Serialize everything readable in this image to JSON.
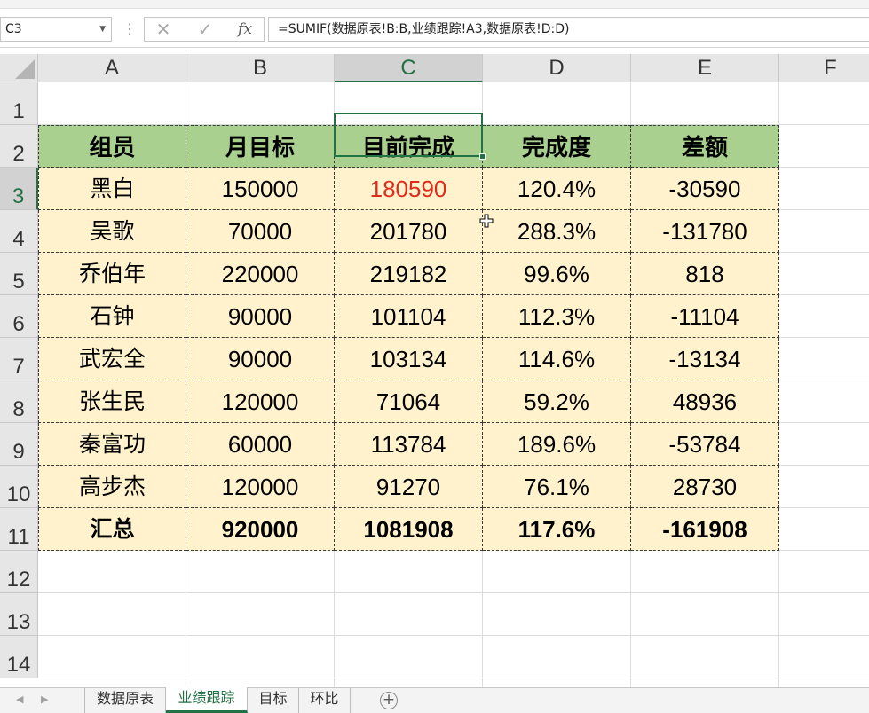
{
  "formula_bar": {
    "name_box": "C3",
    "formula": "=SUMIF(数据原表!B:B,业绩跟踪!A3,数据原表!D:D)",
    "cancel_symbol": "✕",
    "enter_symbol": "✓",
    "fx_symbol": "fx"
  },
  "columns": [
    "A",
    "B",
    "C",
    "D",
    "E",
    "F"
  ],
  "rows": [
    "1",
    "2",
    "3",
    "4",
    "5",
    "6",
    "7",
    "8",
    "9",
    "10",
    "11",
    "12",
    "13",
    "14"
  ],
  "table": {
    "header": [
      "组员",
      "月目标",
      "目前完成",
      "完成度",
      "差额"
    ],
    "rows": [
      [
        "黑白",
        "150000",
        "180590",
        "120.4%",
        "-30590"
      ],
      [
        "吴歌",
        "70000",
        "201780",
        "288.3%",
        "-131780"
      ],
      [
        "乔伯年",
        "220000",
        "219182",
        "99.6%",
        "818"
      ],
      [
        "石钟",
        "90000",
        "101104",
        "112.3%",
        "-11104"
      ],
      [
        "武宏全",
        "90000",
        "103134",
        "114.6%",
        "-13134"
      ],
      [
        "张生民",
        "120000",
        "71064",
        "59.2%",
        "48936"
      ],
      [
        "秦富功",
        "60000",
        "113784",
        "189.6%",
        "-53784"
      ],
      [
        "高步杰",
        "120000",
        "91270",
        "76.1%",
        "28730"
      ]
    ],
    "total": [
      "汇总",
      "920000",
      "1081908",
      "117.6%",
      "-161908"
    ]
  },
  "sheet_tabs": [
    "数据原表",
    "业绩跟踪",
    "目标",
    "环比"
  ],
  "add_sheet": "+",
  "colors": {
    "accent": "#217346",
    "header_fill": "#a9d08e",
    "body_fill": "#fff2cc",
    "highlight_text": "#e02b1c"
  }
}
